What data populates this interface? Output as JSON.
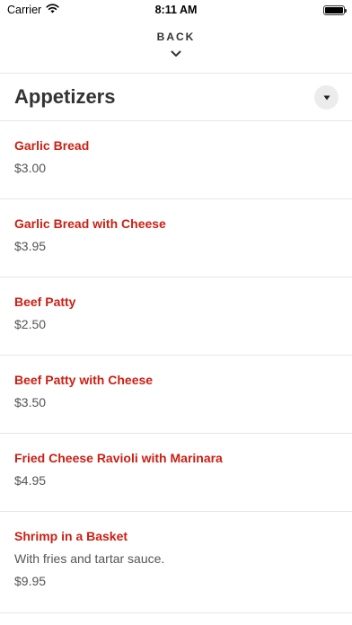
{
  "status_bar": {
    "carrier": "Carrier",
    "time": "8:11 AM"
  },
  "header": {
    "back_label": "BACK"
  },
  "section": {
    "title": "Appetizers"
  },
  "items": [
    {
      "name": "Garlic Bread",
      "price": "$3.00"
    },
    {
      "name": "Garlic Bread with Cheese",
      "price": "$3.95"
    },
    {
      "name": "Beef Patty",
      "price": "$2.50"
    },
    {
      "name": "Beef Patty with Cheese",
      "price": "$3.50"
    },
    {
      "name": "Fried Cheese Ravioli with Marinara",
      "price": "$4.95"
    },
    {
      "name": "Shrimp in a Basket",
      "description": "With fries and tartar sauce.",
      "price": "$9.95"
    }
  ],
  "colors": {
    "item_name": "#cc1f13",
    "divider": "#e6e6e6",
    "dropdown_bg": "#ececec"
  },
  "icons": {
    "wifi": "wifi-icon",
    "battery": "battery-icon",
    "back": "chevron-down-icon",
    "dropdown": "caret-down-icon"
  }
}
